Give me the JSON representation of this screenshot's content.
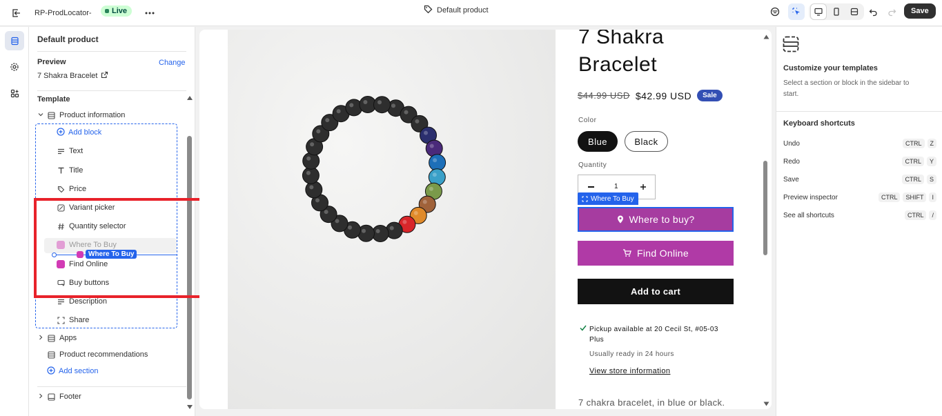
{
  "topbar": {
    "exit_icon": "exit-icon",
    "app_name": "RP-ProdLocator-",
    "status": "Live",
    "more_icon": "more-icon",
    "template_icon": "tag-icon",
    "template_title": "Default product",
    "save_label": "Save"
  },
  "sidebar": {
    "heading": "Default product",
    "preview_label": "Preview",
    "change_label": "Change",
    "product_name": "7 Shakra Bracelet",
    "template_label": "Template",
    "section_name": "Product information",
    "add_block_label": "Add block",
    "blocks": [
      {
        "label": "Text",
        "icon": "text-icon"
      },
      {
        "label": "Title",
        "icon": "title-icon"
      },
      {
        "label": "Price",
        "icon": "price-tag-icon"
      },
      {
        "label": "Variant picker",
        "icon": "variant-icon"
      },
      {
        "label": "Quantity selector",
        "icon": "hash-icon"
      },
      {
        "label": "Where To Buy",
        "icon": "app-icon"
      },
      {
        "label": "Find Online",
        "icon": "app-icon"
      },
      {
        "label": "Buy buttons",
        "icon": "buy-buttons-icon"
      },
      {
        "label": "Description",
        "icon": "text-icon"
      },
      {
        "label": "Share",
        "icon": "share-icon"
      }
    ],
    "drag_label": "Where To Buy",
    "apps_label": "Apps",
    "recommendations_label": "Product recommendations",
    "add_section_label": "Add section",
    "footer_label": "Footer"
  },
  "preview": {
    "title_line1": "7 Shakra",
    "title_line2": "Bracelet",
    "compare_price": "$44.99 USD",
    "price": "$42.99 USD",
    "sale_badge": "Sale",
    "color_label": "Color",
    "color_options": [
      "Blue",
      "Black"
    ],
    "quantity_label": "Quantity",
    "quantity_value": "1",
    "block_tag": "Where To Buy",
    "where_to_buy_label": "Where to buy?",
    "find_online_label": "Find Online",
    "add_to_cart_label": "Add to cart",
    "pickup_text_line1": "Pickup available at 20 Cecil St, #05-03",
    "pickup_text_line2": "Plus",
    "ready_text": "Usually ready in 24 hours",
    "store_link": "View store information",
    "description": "7 chakra bracelet, in blue or black.",
    "accent_color": "#a63ca0",
    "sale_color": "#334fb4"
  },
  "rightpanel": {
    "heading": "Customize your templates",
    "subtext": "Select a section or block in the sidebar to start.",
    "shortcuts_heading": "Keyboard shortcuts",
    "shortcuts": [
      {
        "label": "Undo",
        "keys": [
          "CTRL",
          "Z"
        ]
      },
      {
        "label": "Redo",
        "keys": [
          "CTRL",
          "Y"
        ]
      },
      {
        "label": "Save",
        "keys": [
          "CTRL",
          "S"
        ]
      },
      {
        "label": "Preview inspector",
        "keys": [
          "CTRL",
          "SHIFT",
          "I"
        ]
      },
      {
        "label": "See all shortcuts",
        "keys": [
          "CTRL",
          "/"
        ]
      }
    ]
  }
}
